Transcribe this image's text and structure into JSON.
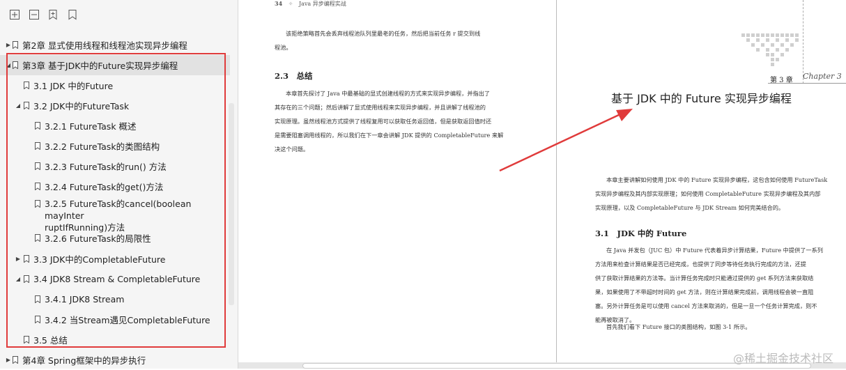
{
  "sidebar": {
    "toolbar": [
      {
        "icon": "expand-all-icon"
      },
      {
        "icon": "collapse-all-icon"
      },
      {
        "icon": "add-bookmark-icon"
      },
      {
        "icon": "bookmark-icon"
      }
    ],
    "items": [
      {
        "label": "第2章 显式使用线程和线程池实现异步编程",
        "toggle": "▶"
      },
      {
        "label": "第3章 基于JDK中的Future实现异步编程",
        "toggle": "◢"
      },
      {
        "label": "3.1 JDK 中的Future",
        "toggle": ""
      },
      {
        "label": "3.2 JDK中的FutureTask",
        "toggle": "◢"
      },
      {
        "label": "3.2.1 FutureTask 概述",
        "toggle": ""
      },
      {
        "label": "3.2.2 FutureTask的类图结构",
        "toggle": ""
      },
      {
        "label": "3.2.3 FutureTask的run() 方法",
        "toggle": ""
      },
      {
        "label": "3.2.4 FutureTask的get()方法",
        "toggle": ""
      },
      {
        "label_line1": "3.2.5 FutureTask的cancel(boolean mayInter",
        "label_line2": "ruptIfRunning)方法",
        "toggle": ""
      },
      {
        "label": "3.2.6 FutureTask的局限性",
        "toggle": ""
      },
      {
        "label": "3.3 JDK中的CompletableFuture",
        "toggle": "▶"
      },
      {
        "label": "3.4 JDK8 Stream & CompletableFuture",
        "toggle": "◢"
      },
      {
        "label": "3.4.1 JDK8 Stream",
        "toggle": ""
      },
      {
        "label": "3.4.2 当Stream遇见CompletableFuture",
        "toggle": ""
      },
      {
        "label": "3.5 总结",
        "toggle": ""
      },
      {
        "label": "第4章 Spring框架中的异步执行",
        "toggle": "▶"
      }
    ]
  },
  "left_page": {
    "page_number": "34",
    "running_header": "Java 异步编程实战",
    "intro_lines": [
      "该拒绝策略首先会丢弃线程池队列里最老的任务，然后把当前任务 r 提交到线",
      "程池。"
    ],
    "section_heading": "2.3　总结",
    "summary_lines": [
      "本章首先探讨了 Java 中最基础的显式创建线程的方式来实现异步编程，并指出了",
      "其存在的三个问题；然后讲解了显式使用线程来实现异步编程，并且讲解了线程池的",
      "实现原理。虽然线程池方式提供了线程复用可以获取任务返回值，但是获取返回值时还",
      "是需要阻塞调用线程的，所以我们在下一章会讲解 JDK 提供的 CompletableFuture 来解",
      "决这个问题。"
    ]
  },
  "right_page": {
    "chapter_tag": "第 3 章",
    "chapter_script": "Chapter 3",
    "chapter_title": "基于 JDK 中的 Future 实现异步编程",
    "intro_lines": [
      "本章主要讲解如何使用 JDK 中的 Future 实现异步编程，这包含如何使用 FutureTask",
      "实现异步编程及其内部实现原理；如何使用 CompletableFuture 实现异步编程及其内部",
      "实现原理，以及 CompletableFuture 与 JDK Stream 如何完美结合的。"
    ],
    "section_heading": "3.1　JDK 中的 Future",
    "body_lines": [
      "在 Java 并发包（JUC 包）中 Future 代表着异步计算结果，Future 中提供了一系列",
      "方法用来检查计算结果是否已经完成，也提供了同步等待任务执行完成的方法，还提",
      "供了获取计算结果的方法等。当计算任务完成时只能通过提供的 get 系列方法来获取结",
      "果，如果使用了不带超时时间的 get 方法，则在计算结果完成前，调用线程会被一直阻",
      "塞。另外计算任务是可以使用 cancel 方法来取消的，但是一旦一个任务计算完成，则不",
      "能再被取消了。"
    ],
    "closing_line": "首先我们看下 Future 接口的类图结构，如图 3-1 所示。"
  },
  "watermark": "@稀土掘金技术社区",
  "colors": {
    "highlight": "#e03b3b",
    "arrow": "#e03b3b",
    "sidebar_bg": "#f5f5f5",
    "selected_bg": "#e2e2e2"
  }
}
